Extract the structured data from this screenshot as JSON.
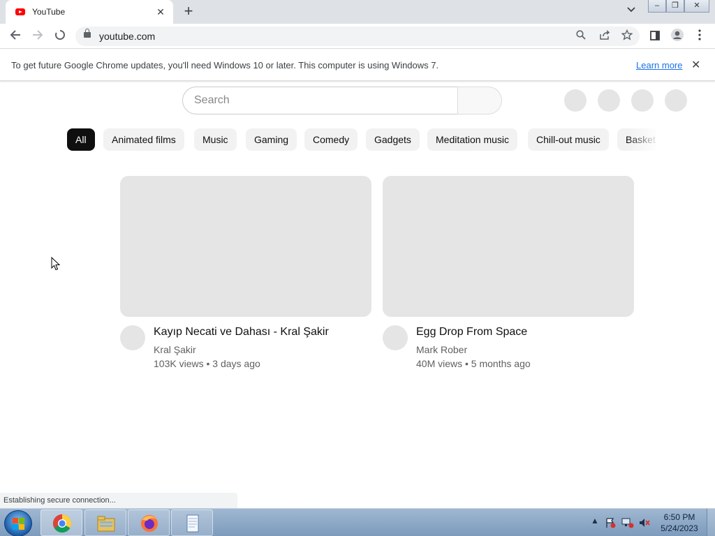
{
  "browser": {
    "tab_title": "YouTube",
    "tab_close": "✕",
    "new_tab": "+",
    "url": "youtube.com",
    "window_controls": {
      "minimize": "–",
      "restore": "❐",
      "close": "✕"
    }
  },
  "infobar": {
    "message": "To get future Google Chrome updates, you'll need Windows 10 or later. This computer is using Windows 7.",
    "learn_more": "Learn more",
    "close": "✕"
  },
  "youtube": {
    "search_placeholder": "Search",
    "chips": [
      "All",
      "Animated films",
      "Music",
      "Gaming",
      "Comedy",
      "Gadgets",
      "Meditation music",
      "Chill-out music",
      "Basket"
    ],
    "videos": [
      {
        "title": "Kayıp Necati ve Dahası - Kral Şakir",
        "channel": "Kral Şakir",
        "meta": "103K views • 3 days ago"
      },
      {
        "title": "Egg Drop From Space",
        "channel": "Mark Rober",
        "meta": "40M views • 5 months ago"
      }
    ]
  },
  "status": {
    "text": "Establishing secure connection..."
  },
  "taskbar": {
    "time": "6:50 PM",
    "date": "5/24/2023",
    "apps": [
      "chrome-icon",
      "file-explorer-icon",
      "firefox-icon",
      "notepad-icon"
    ]
  },
  "colors": {
    "accent": "#1a73e8",
    "youtube_red": "#ff0000",
    "chip_active": "#0f0f0f"
  }
}
